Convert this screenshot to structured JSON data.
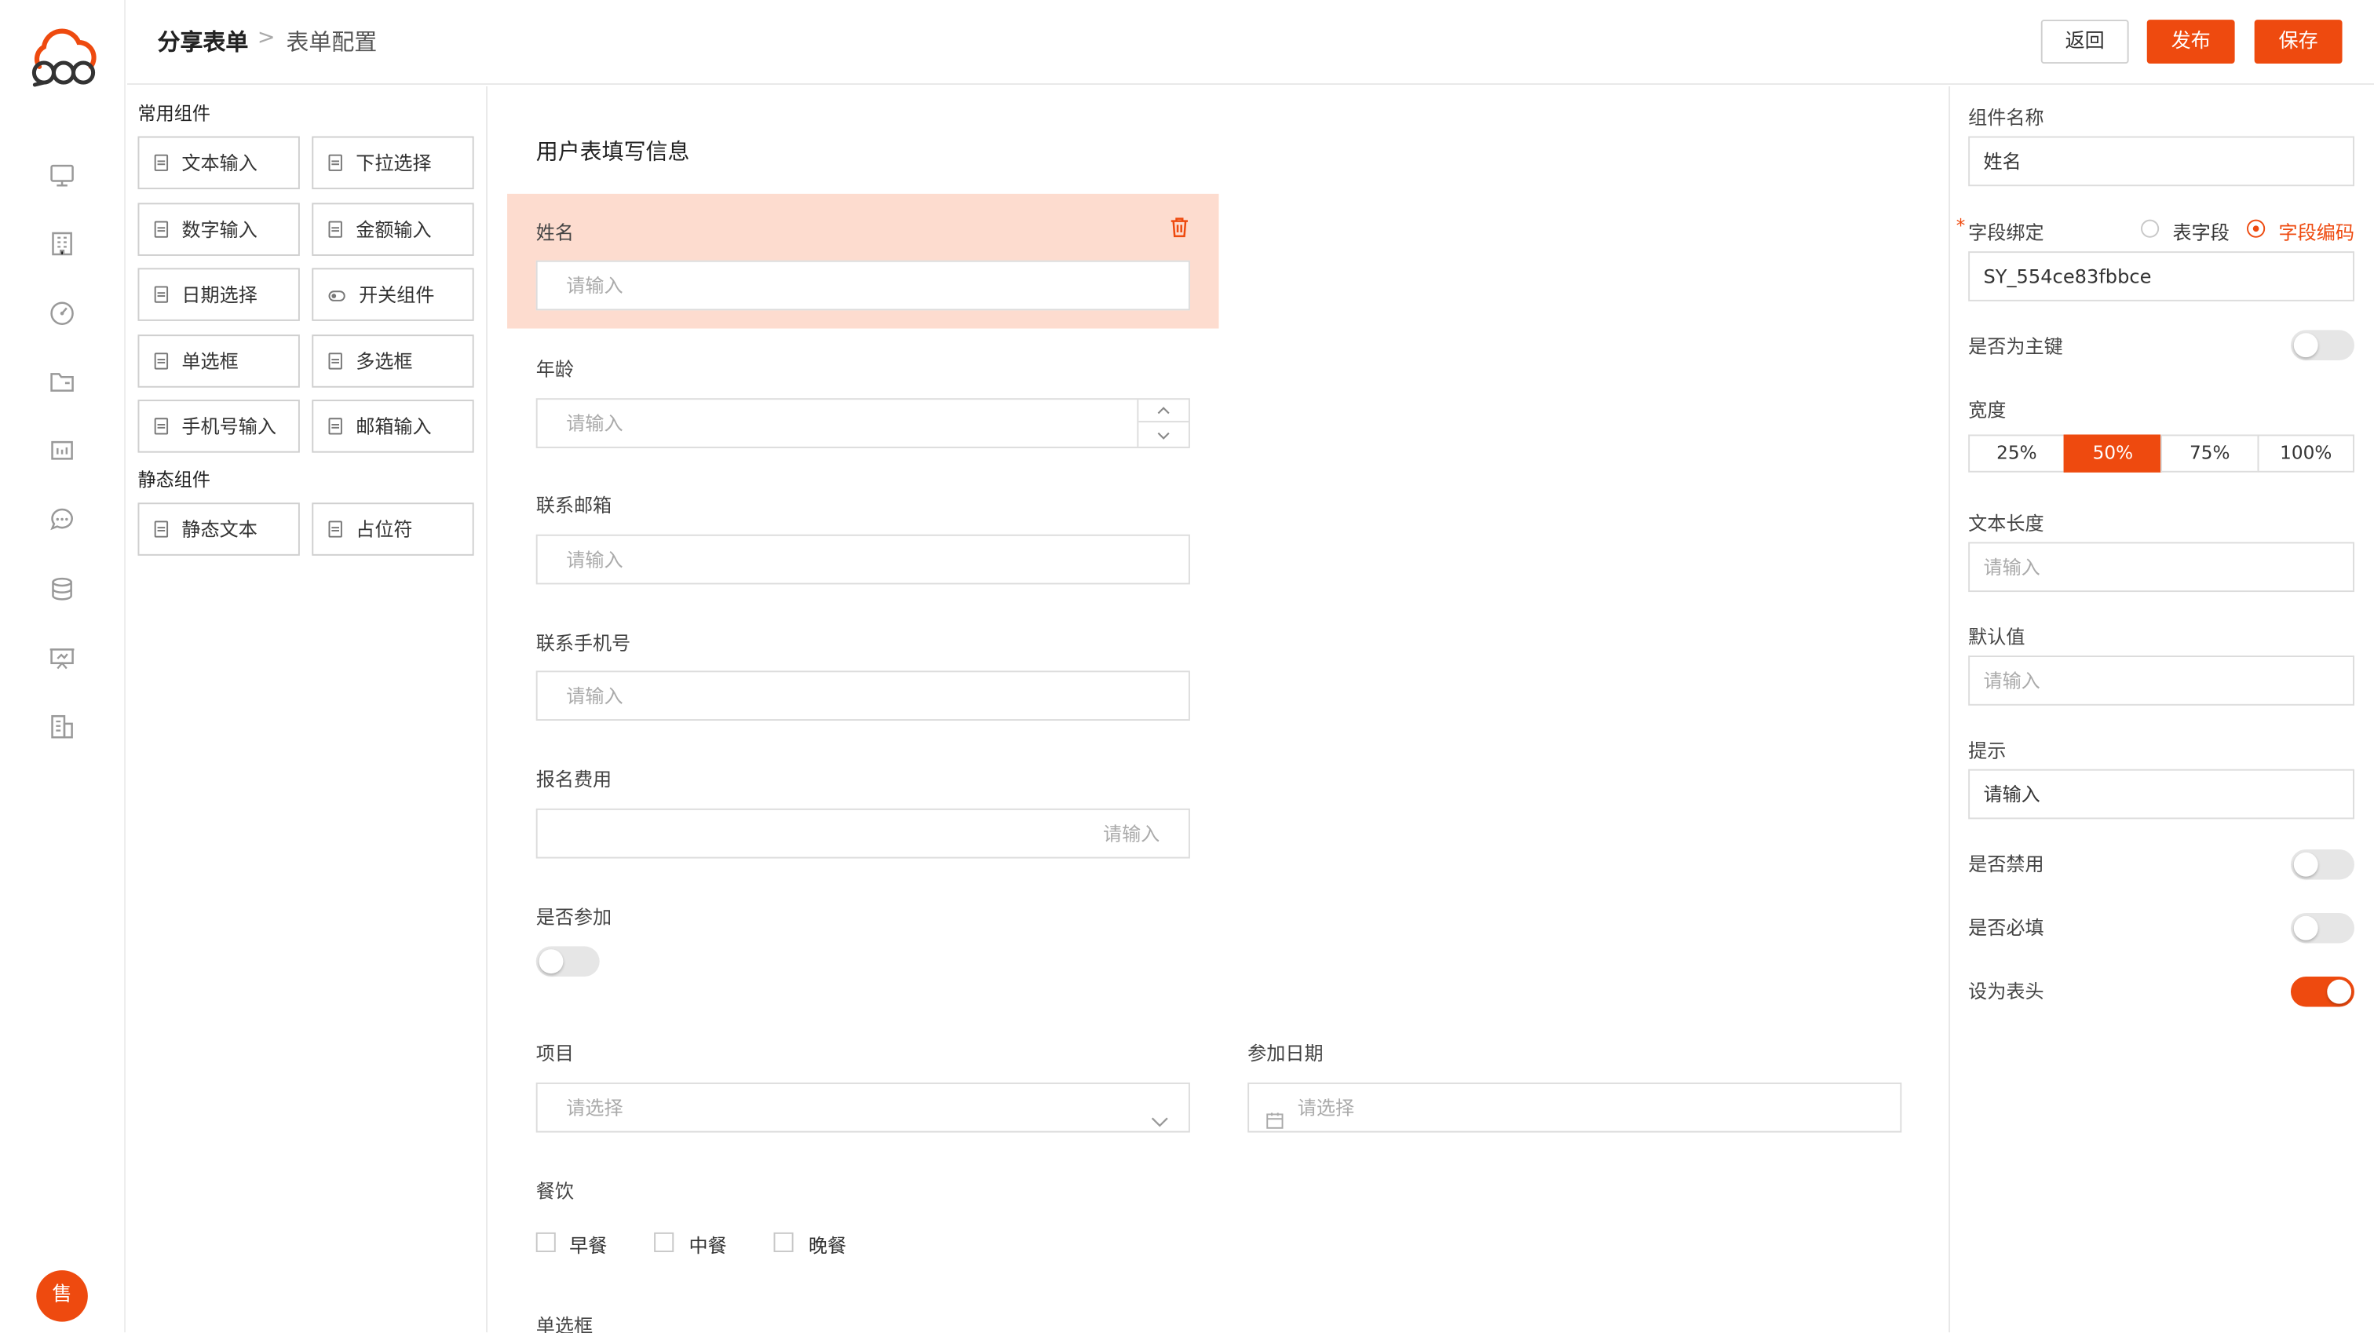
{
  "header": {
    "breadcrumb_root": "分享表单",
    "breadcrumb_separator": ">",
    "breadcrumb_current": "表单配置",
    "back_label": "返回",
    "publish_label": "发布",
    "save_label": "保存"
  },
  "sidebar": {
    "avatar_text": "售",
    "icons": [
      "monitor-icon",
      "building-icon",
      "gauge-icon",
      "folder-icon",
      "dashboard-icon",
      "chat-icon",
      "database-icon",
      "presentation-icon",
      "office-icon"
    ]
  },
  "components": {
    "common_title": "常用组件",
    "common": [
      "文本输入",
      "下拉选择",
      "数字输入",
      "金额输入",
      "日期选择",
      "开关组件",
      "单选框",
      "多选框",
      "手机号输入",
      "邮箱输入"
    ],
    "static_title": "静态组件",
    "static": [
      "静态文本",
      "占位符"
    ]
  },
  "form": {
    "title": "用户表填写信息",
    "fields": {
      "name": {
        "label": "姓名",
        "placeholder": "请输入"
      },
      "age": {
        "label": "年龄",
        "placeholder": "请输入"
      },
      "email": {
        "label": "联系邮箱",
        "placeholder": "请输入"
      },
      "phone": {
        "label": "联系手机号",
        "placeholder": "请输入"
      },
      "fee": {
        "label": "报名费用",
        "placeholder": "请输入"
      },
      "attend": {
        "label": "是否参加",
        "value": false
      },
      "project": {
        "label": "项目",
        "placeholder": "请选择"
      },
      "date": {
        "label": "参加日期",
        "placeholder": "请选择"
      },
      "meal": {
        "label": "餐饮",
        "options": [
          "早餐",
          "中餐",
          "晚餐"
        ]
      },
      "radio": {
        "label": "单选框"
      }
    }
  },
  "properties": {
    "component_name_label": "组件名称",
    "component_name_value": "姓名",
    "field_binding_required_mark": "*",
    "field_binding_label": "字段绑定",
    "binding_option_table": "表字段",
    "binding_option_code": "字段编码",
    "binding_selected": "字段编码",
    "field_code_value": "SY_554ce83fbbce",
    "primary_key_label": "是否为主键",
    "primary_key_value": false,
    "width_label": "宽度",
    "width_options": [
      "25%",
      "50%",
      "75%",
      "100%"
    ],
    "width_selected": "50%",
    "text_length_label": "文本长度",
    "text_length_placeholder": "请输入",
    "default_label": "默认值",
    "default_placeholder": "请输入",
    "hint_label": "提示",
    "hint_value": "请输入",
    "disabled_label": "是否禁用",
    "disabled_value": false,
    "required_label": "是否必填",
    "required_value": false,
    "header_label": "设为表头",
    "header_value": true
  },
  "colors": {
    "accent": "#ee4a0f",
    "selected_block": "#fddccf",
    "border": "#dcdcdc"
  }
}
